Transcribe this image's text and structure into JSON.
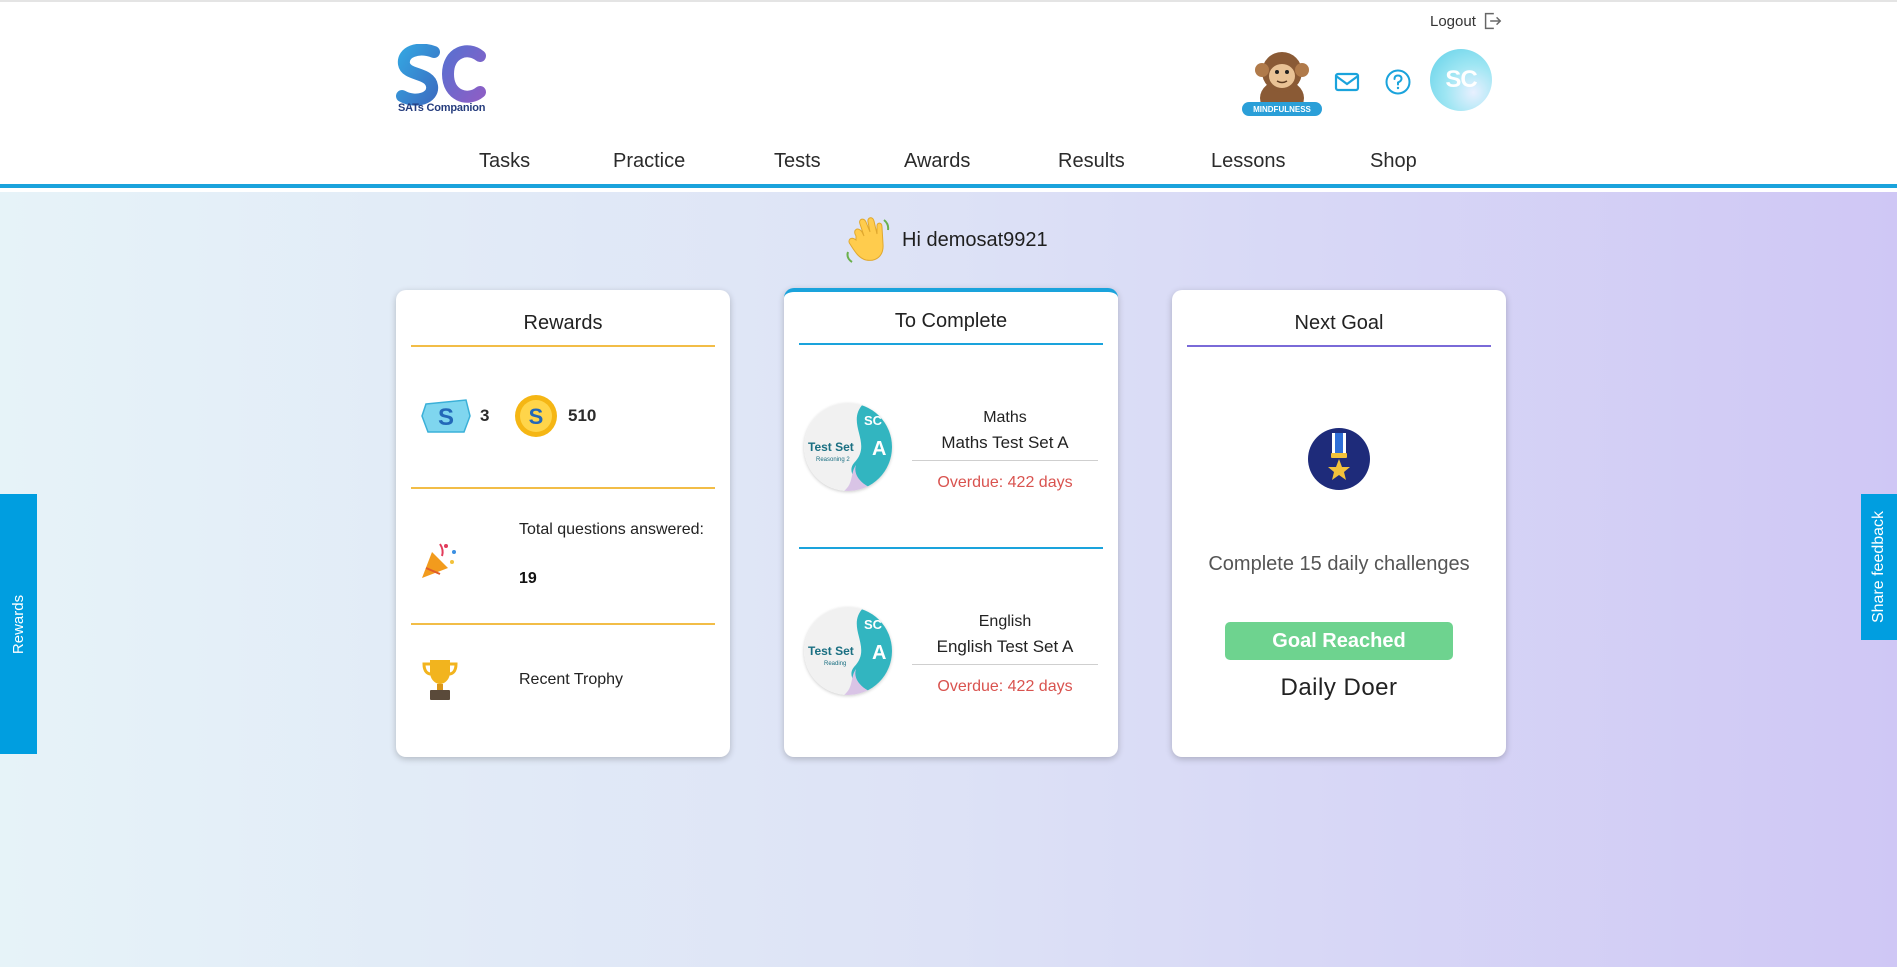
{
  "header": {
    "logo_text": "SATs Companion",
    "logout_label": "Logout",
    "mascot_badge": "MINDFULNESS",
    "avatar_initials": "SC"
  },
  "nav": {
    "items": [
      {
        "label": "Tasks"
      },
      {
        "label": "Practice"
      },
      {
        "label": "Tests"
      },
      {
        "label": "Awards"
      },
      {
        "label": "Results"
      },
      {
        "label": "Lessons"
      },
      {
        "label": "Shop"
      }
    ]
  },
  "greeting": "Hi demosat9921",
  "rewards": {
    "title": "Rewards",
    "gems": "3",
    "coins": "510",
    "total_questions_label": "Total questions answered:",
    "total_questions_value": "19",
    "recent_trophy_label": "Recent Trophy"
  },
  "to_complete": {
    "title": "To Complete",
    "items": [
      {
        "subject": "Maths",
        "name": "Maths Test Set A",
        "due": "Overdue: 422 days",
        "thumb_title": "Test Set",
        "thumb_sub": "Reasoning 2",
        "thumb_letter": "A"
      },
      {
        "subject": "English",
        "name": "English Test Set A",
        "due": "Overdue: 422 days",
        "thumb_title": "Test Set",
        "thumb_sub": "Reading",
        "thumb_letter": "A"
      }
    ]
  },
  "next_goal": {
    "title": "Next Goal",
    "description": "Complete 15 daily challenges",
    "status_label": "Goal Reached",
    "award_name": "Daily Doer"
  },
  "side_tabs": {
    "left": "Rewards",
    "right": "Share feedback"
  },
  "colors": {
    "accent_blue": "#1aa3dc",
    "rewards_gold": "#f2bd47",
    "goal_purple": "#7a6ad8",
    "overdue_red": "#d9534f",
    "goal_green": "#6ed38f"
  }
}
